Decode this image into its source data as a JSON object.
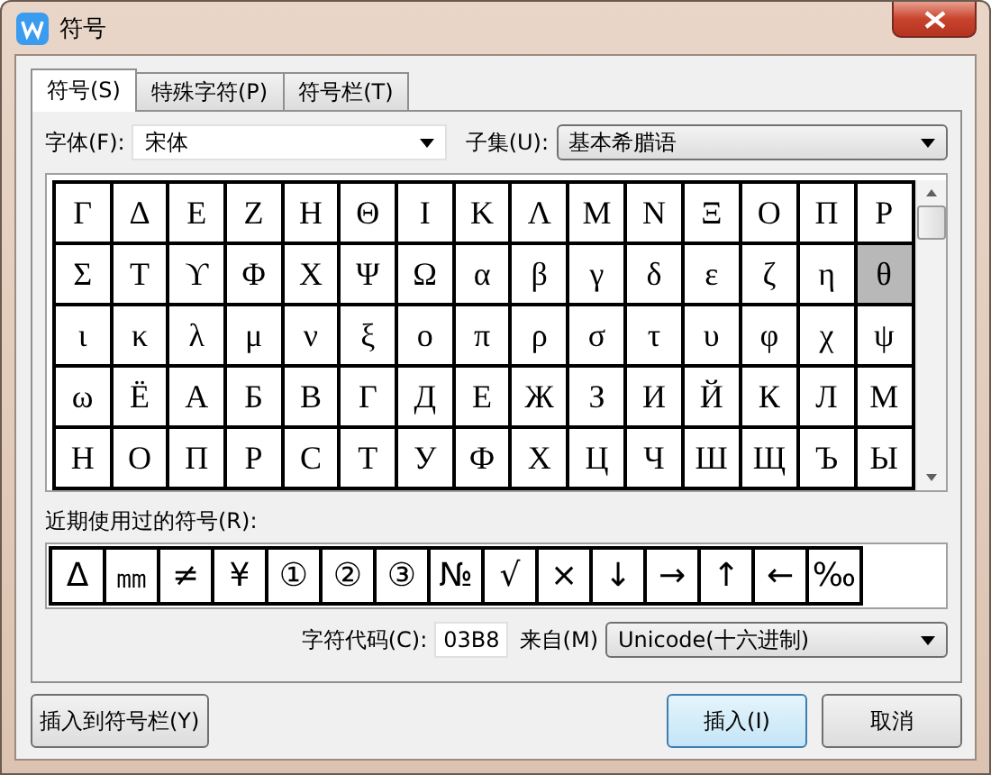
{
  "window": {
    "title": "符号"
  },
  "tabs": [
    {
      "label": "符号(S)",
      "selected": true
    },
    {
      "label": "特殊字符(P)",
      "selected": false
    },
    {
      "label": "符号栏(T)",
      "selected": false
    }
  ],
  "font": {
    "label": "字体(F):",
    "value": "宋体"
  },
  "subset": {
    "label": "子集(U):",
    "value": "基本希腊语"
  },
  "symbol_grid": [
    {
      "cells": [
        {
          "char": "Γ",
          "selected": false
        },
        {
          "char": "Δ",
          "selected": false
        },
        {
          "char": "Ε",
          "selected": false
        },
        {
          "char": "Ζ",
          "selected": false
        },
        {
          "char": "Η",
          "selected": false
        },
        {
          "char": "Θ",
          "selected": false
        },
        {
          "char": "Ι",
          "selected": false
        },
        {
          "char": "Κ",
          "selected": false
        },
        {
          "char": "Λ",
          "selected": false
        },
        {
          "char": "Μ",
          "selected": false
        },
        {
          "char": "Ν",
          "selected": false
        },
        {
          "char": "Ξ",
          "selected": false
        },
        {
          "char": "Ο",
          "selected": false
        },
        {
          "char": "Π",
          "selected": false
        },
        {
          "char": "Ρ",
          "selected": false
        }
      ]
    },
    {
      "cells": [
        {
          "char": "Σ",
          "selected": false
        },
        {
          "char": "Τ",
          "selected": false
        },
        {
          "char": "ϒ",
          "selected": false
        },
        {
          "char": "Φ",
          "selected": false
        },
        {
          "char": "Χ",
          "selected": false
        },
        {
          "char": "Ψ",
          "selected": false
        },
        {
          "char": "Ω",
          "selected": false
        },
        {
          "char": "α",
          "selected": false
        },
        {
          "char": "β",
          "selected": false
        },
        {
          "char": "γ",
          "selected": false
        },
        {
          "char": "δ",
          "selected": false
        },
        {
          "char": "ε",
          "selected": false
        },
        {
          "char": "ζ",
          "selected": false
        },
        {
          "char": "η",
          "selected": false
        },
        {
          "char": "θ",
          "selected": true
        }
      ]
    },
    {
      "cells": [
        {
          "char": "ι",
          "selected": false
        },
        {
          "char": "κ",
          "selected": false
        },
        {
          "char": "λ",
          "selected": false
        },
        {
          "char": "μ",
          "selected": false
        },
        {
          "char": "ν",
          "selected": false
        },
        {
          "char": "ξ",
          "selected": false
        },
        {
          "char": "ο",
          "selected": false
        },
        {
          "char": "π",
          "selected": false
        },
        {
          "char": "ρ",
          "selected": false
        },
        {
          "char": "σ",
          "selected": false
        },
        {
          "char": "τ",
          "selected": false
        },
        {
          "char": "υ",
          "selected": false
        },
        {
          "char": "φ",
          "selected": false
        },
        {
          "char": "χ",
          "selected": false
        },
        {
          "char": "ψ",
          "selected": false
        }
      ]
    },
    {
      "cells": [
        {
          "char": "ω",
          "selected": false
        },
        {
          "char": "Ё",
          "selected": false
        },
        {
          "char": "А",
          "selected": false
        },
        {
          "char": "Б",
          "selected": false
        },
        {
          "char": "В",
          "selected": false
        },
        {
          "char": "Г",
          "selected": false
        },
        {
          "char": "Д",
          "selected": false
        },
        {
          "char": "Е",
          "selected": false
        },
        {
          "char": "Ж",
          "selected": false
        },
        {
          "char": "З",
          "selected": false
        },
        {
          "char": "И",
          "selected": false
        },
        {
          "char": "Й",
          "selected": false
        },
        {
          "char": "К",
          "selected": false
        },
        {
          "char": "Л",
          "selected": false
        },
        {
          "char": "М",
          "selected": false
        }
      ]
    },
    {
      "cells": [
        {
          "char": "Н",
          "selected": false
        },
        {
          "char": "О",
          "selected": false
        },
        {
          "char": "П",
          "selected": false
        },
        {
          "char": "Р",
          "selected": false
        },
        {
          "char": "С",
          "selected": false
        },
        {
          "char": "Т",
          "selected": false
        },
        {
          "char": "У",
          "selected": false
        },
        {
          "char": "Ф",
          "selected": false
        },
        {
          "char": "Х",
          "selected": false
        },
        {
          "char": "Ц",
          "selected": false
        },
        {
          "char": "Ч",
          "selected": false
        },
        {
          "char": "Ш",
          "selected": false
        },
        {
          "char": "Щ",
          "selected": false
        },
        {
          "char": "Ъ",
          "selected": false
        },
        {
          "char": "Ы",
          "selected": false
        }
      ]
    }
  ],
  "recent": {
    "label": "近期使用过的符号(R):",
    "symbols": [
      "Δ",
      "㎜",
      "≠",
      "¥",
      "①",
      "②",
      "③",
      "№",
      "√",
      "×",
      "↓",
      "→",
      "↑",
      "←",
      "‰"
    ]
  },
  "char_code": {
    "label": "字符代码(C):",
    "value": "03B8"
  },
  "source": {
    "label": "来自(M)",
    "value": "Unicode(十六进制)"
  },
  "buttons": [
    {
      "label": "插入到符号栏(Y)",
      "default": false
    },
    {
      "label": "插入(I)",
      "default": true
    },
    {
      "label": "取消",
      "default": false
    }
  ]
}
